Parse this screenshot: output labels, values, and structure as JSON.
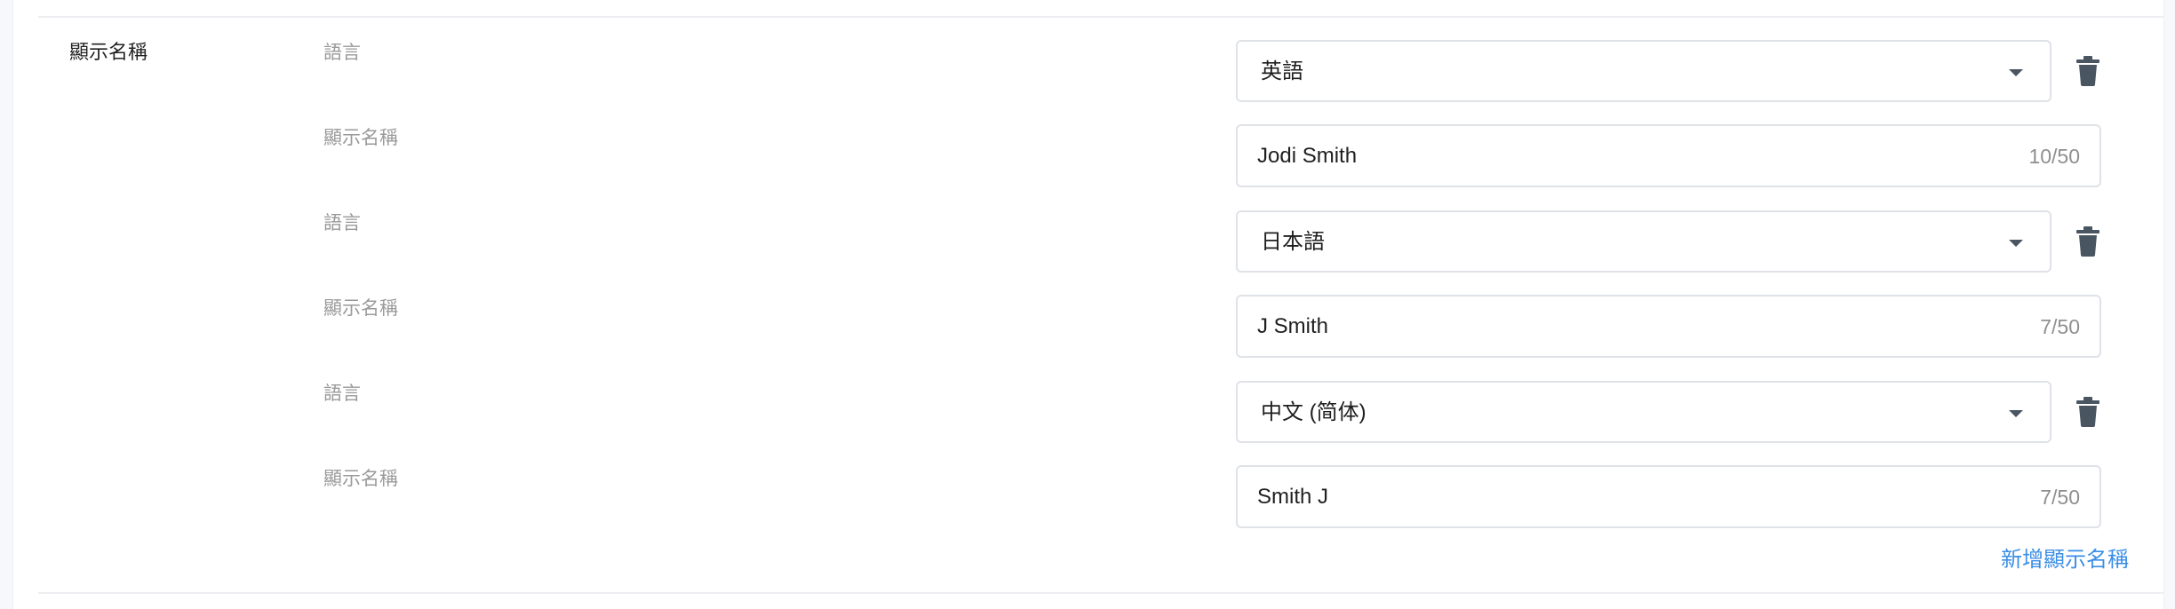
{
  "section": {
    "label": "顯示名稱"
  },
  "labels": {
    "language": "語言",
    "display_name": "顯示名稱"
  },
  "entries": [
    {
      "language": "英語",
      "display_name": "Jodi Smith",
      "counter": "10/50"
    },
    {
      "language": "日本語",
      "display_name": "J Smith",
      "counter": "7/50"
    },
    {
      "language": "中文 (简体)",
      "display_name": "Smith J",
      "counter": "7/50"
    }
  ],
  "actions": {
    "add_display_name": "新增顯示名稱"
  },
  "icons": {
    "delete": "trash-icon",
    "dropdown": "chevron-down-icon"
  },
  "colors": {
    "link": "#3a8ee6",
    "icon": "#4a5562",
    "border": "#dfe2e7"
  }
}
